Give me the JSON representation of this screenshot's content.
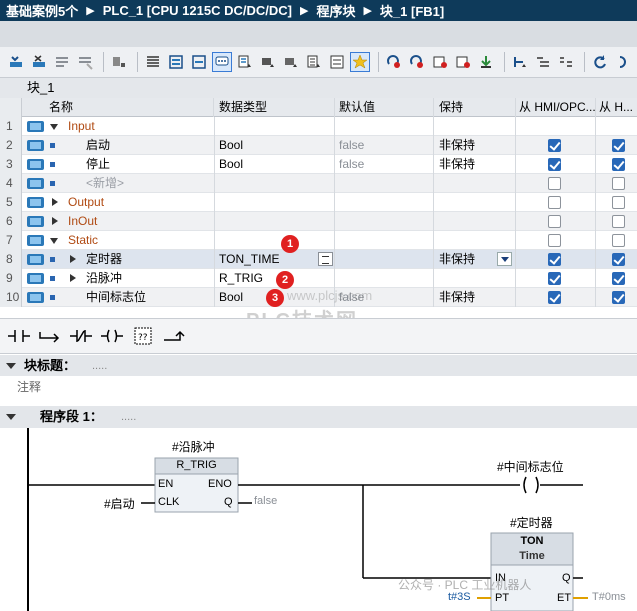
{
  "titlebar": {
    "crumbs": [
      "基础案例5个",
      "PLC_1 [CPU 1215C DC/DC/DC]",
      "程序块",
      "块_1 [FB1]"
    ]
  },
  "block_name": "块_1",
  "table": {
    "headers": {
      "name": "名称",
      "type": "数据类型",
      "default": "默认值",
      "retain": "保持",
      "hmi": "从 HMI/OPC...",
      "h2": "从 H..."
    },
    "rows": [
      {
        "num": "1",
        "name": "Input",
        "type": "",
        "default": "",
        "retain": "",
        "kind": "section",
        "expand": "down",
        "hmi": null,
        "h2": null
      },
      {
        "num": "2",
        "name": "启动",
        "type": "Bool",
        "default": "false",
        "retain": "非保持",
        "kind": "var",
        "hmi": true,
        "h2": true
      },
      {
        "num": "3",
        "name": "停止",
        "type": "Bool",
        "default": "false",
        "retain": "非保持",
        "kind": "var",
        "hmi": true,
        "h2": true
      },
      {
        "num": "4",
        "name": "<新增>",
        "type": "",
        "default": "",
        "retain": "",
        "kind": "add",
        "hmi": false,
        "h2": false
      },
      {
        "num": "5",
        "name": "Output",
        "type": "",
        "default": "",
        "retain": "",
        "kind": "section",
        "expand": "right",
        "hmi": false,
        "h2": false
      },
      {
        "num": "6",
        "name": "InOut",
        "type": "",
        "default": "",
        "retain": "",
        "kind": "section",
        "expand": "right",
        "hmi": false,
        "h2": false
      },
      {
        "num": "7",
        "name": "Static",
        "type": "",
        "default": "",
        "retain": "",
        "kind": "section",
        "expand": "down",
        "hmi": false,
        "h2": false
      },
      {
        "num": "8",
        "name": "定时器",
        "type": "TON_TIME",
        "default": "",
        "retain": "非保持",
        "kind": "struct",
        "hmi": true,
        "h2": true
      },
      {
        "num": "9",
        "name": "沿脉冲",
        "type": "R_TRIG",
        "default": "",
        "retain": "",
        "kind": "struct",
        "hmi": true,
        "h2": true
      },
      {
        "num": "10",
        "name": "中间标志位",
        "type": "Bool",
        "default": "false",
        "retain": "非保持",
        "kind": "var",
        "hmi": true,
        "h2": true
      }
    ],
    "markers": [
      "1",
      "2",
      "3"
    ]
  },
  "block_title": {
    "label": "块标题：",
    "dots": "....."
  },
  "comment": "注释",
  "network": {
    "label": "程序段 1：",
    "dots": "....."
  },
  "ladder": {
    "rtrig_instance": "#沿脉冲",
    "rtrig_type": "R_TRIG",
    "en": "EN",
    "eno": "ENO",
    "clk": "CLK",
    "q": "Q",
    "clk_input": "#启动",
    "q_output": "false",
    "coil_label": "#中间标志位",
    "ton_instance": "#定时器",
    "ton_type": "TON",
    "ton_sub": "Time",
    "in": "IN",
    "pt": "PT",
    "et": "ET",
    "q2": "Q",
    "pt_value": "t#3S",
    "et_value": "T#0ms"
  },
  "watermarks": {
    "url": "www.plcjs.com",
    "brand": "PLC技术网",
    "wechat": "公众号 · PLC 工业机器人"
  }
}
